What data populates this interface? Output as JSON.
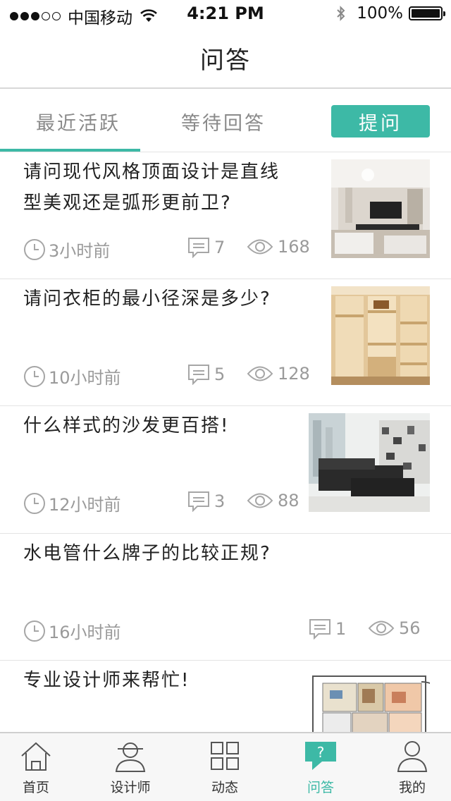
{
  "status_bar": {
    "carrier": "中国移动",
    "time": "4:21 PM",
    "battery": "100%"
  },
  "nav": {
    "title": "问答"
  },
  "tabs": {
    "recent_label": "最近活跃",
    "waiting_label": "等待回答",
    "ask_label": "提问"
  },
  "questions": [
    {
      "title_line1": "请问现代风格顶面设计是直线",
      "title_line2": "型美观还是弧形更前卫?",
      "time": "3小时前",
      "comments": "7",
      "views": "168",
      "image": "modern-living-room-photo"
    },
    {
      "title_line1": "请问衣柜的最小径深是多少?",
      "title_line2": "",
      "time": "10小时前",
      "comments": "5",
      "views": "128",
      "image": "wardrobe-photo"
    },
    {
      "title_line1": "什么样式的沙发更百搭!",
      "title_line2": "",
      "time": "12小时前",
      "comments": "3",
      "views": "88",
      "image": "leather-sofa-photo"
    },
    {
      "title_line1": "水电管什么牌子的比较正规?",
      "title_line2": "",
      "time": "16小时前",
      "comments": "1",
      "views": "56",
      "image": ""
    },
    {
      "title_line1": "专业设计师来帮忙!",
      "title_line2": "",
      "time": "",
      "comments": "",
      "views": "",
      "image": "floor-plan-photo"
    }
  ],
  "tabbar": {
    "items": [
      {
        "label": "首页",
        "icon": "home-icon"
      },
      {
        "label": "设计师",
        "icon": "designer-icon"
      },
      {
        "label": "动态",
        "icon": "grid-icon"
      },
      {
        "label": "问答",
        "icon": "qa-icon",
        "badge": "?"
      },
      {
        "label": "我的",
        "icon": "profile-icon"
      }
    ]
  },
  "colors": {
    "accent": "#3db9a6",
    "meta_gray": "#9a9a9a",
    "divider": "#e3e3e3"
  }
}
